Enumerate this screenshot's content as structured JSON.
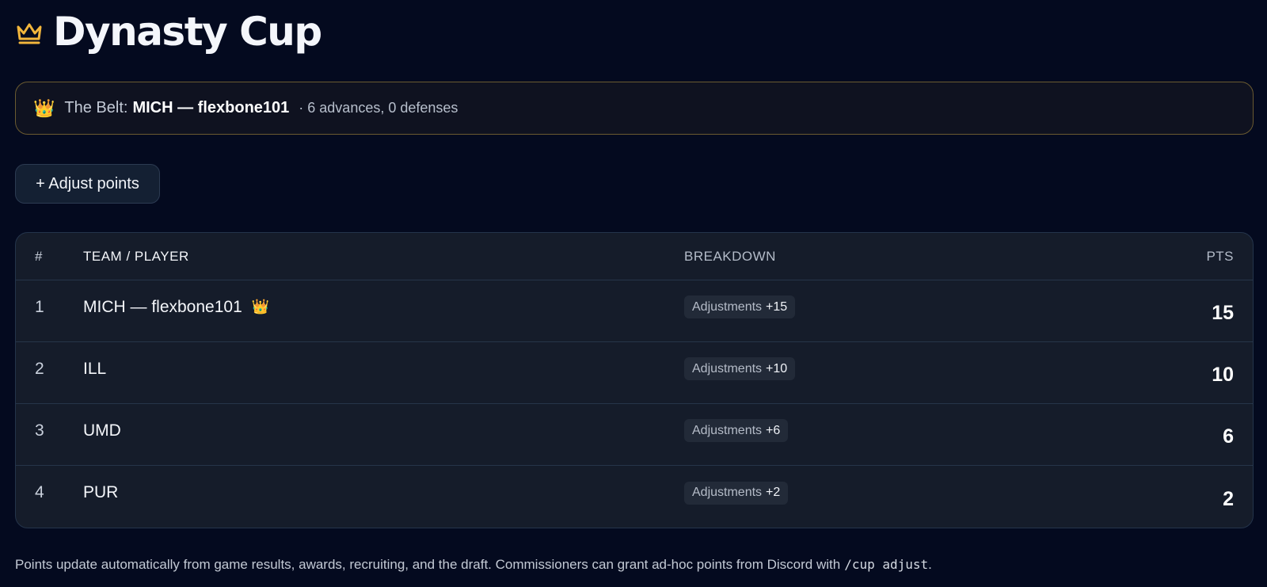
{
  "header": {
    "title": "Dynasty Cup",
    "icon": "crown-icon",
    "accent": "#f2b63c"
  },
  "belt": {
    "emoji": "👑",
    "label": "The Belt:",
    "holder": "MICH — flexbone101",
    "stats": "· 6 advances, 0 defenses"
  },
  "actions": {
    "adjust_label": "+ Adjust points"
  },
  "table": {
    "headers": {
      "rank": "#",
      "team": "TEAM / PLAYER",
      "breakdown": "BREAKDOWN",
      "pts": "PTS"
    },
    "rows": [
      {
        "rank": "1",
        "team": "MICH — flexbone101",
        "crown": "👑",
        "chip_label": "Adjustments",
        "chip_value": "+15",
        "pts": "15"
      },
      {
        "rank": "2",
        "team": "ILL",
        "chip_label": "Adjustments",
        "chip_value": "+10",
        "pts": "10"
      },
      {
        "rank": "3",
        "team": "UMD",
        "chip_label": "Adjustments",
        "chip_value": "+6",
        "pts": "6"
      },
      {
        "rank": "4",
        "team": "PUR",
        "chip_label": "Adjustments",
        "chip_value": "+2",
        "pts": "2"
      }
    ]
  },
  "footer": {
    "text": "Points update automatically from game results, awards, recruiting, and the draft. Commissioners can grant ad-hoc points from Discord with",
    "command": "/cup adjust",
    "end": "."
  }
}
